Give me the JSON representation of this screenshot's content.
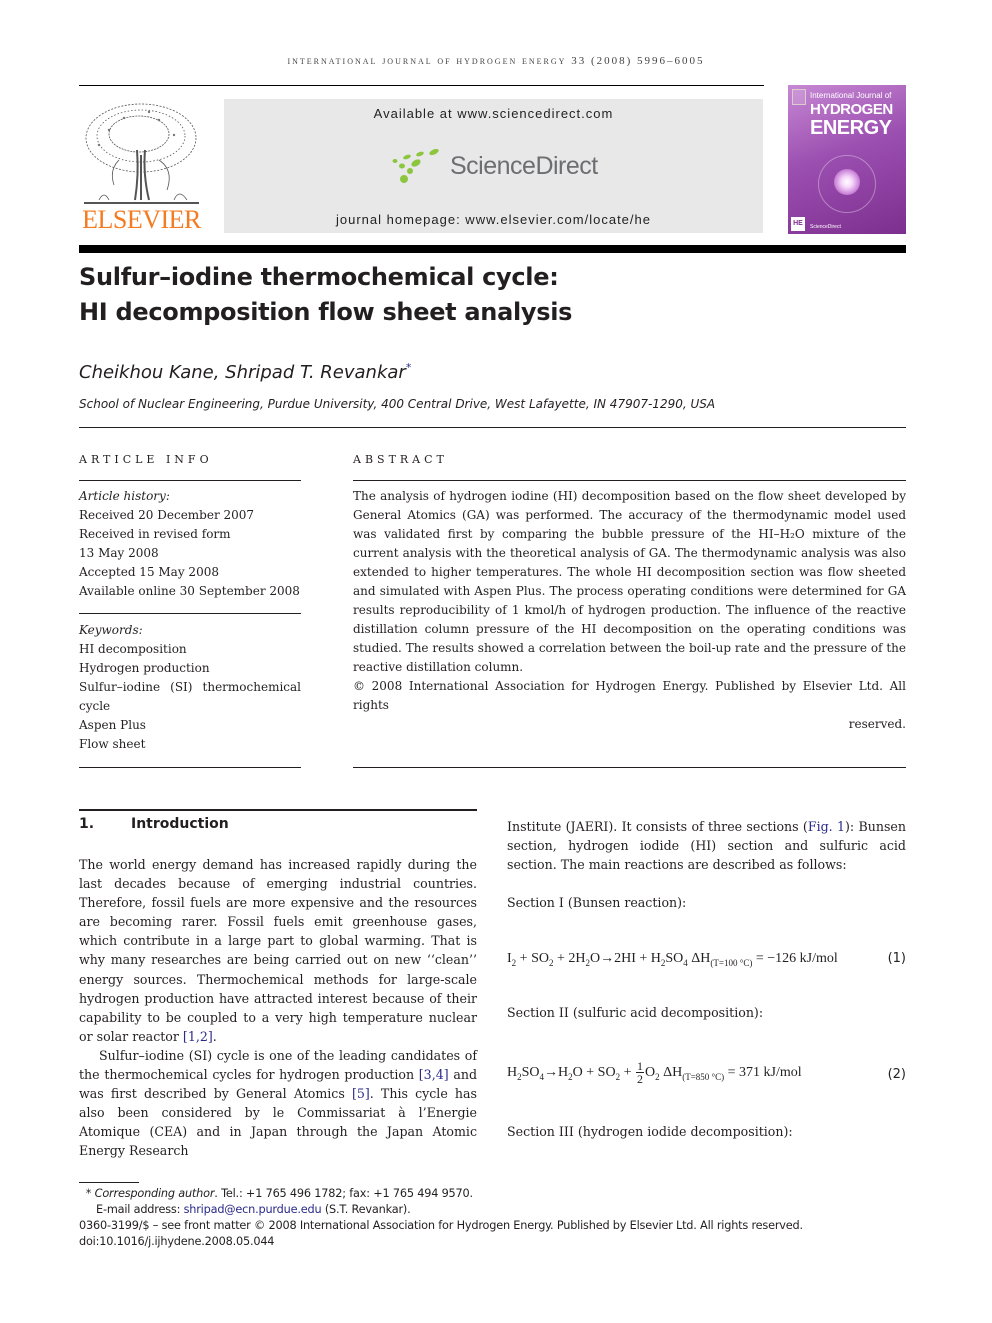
{
  "running_head": "INTERNATIONAL JOURNAL OF HYDROGEN ENERGY 33 (2008) 5996–6005",
  "publisher": {
    "name": "ELSEVIER",
    "color": "#f47b20"
  },
  "sciencedirect": {
    "available": "Available at www.sciencedirect.com",
    "logo_text": "ScienceDirect",
    "homepage": "journal homepage: www.elsevier.com/locate/he",
    "logo_color": "#8cc63f"
  },
  "cover": {
    "line1": "International Journal of",
    "line2": "HYDROGEN",
    "line3": "ENERGY",
    "badge": "HE",
    "footer": "ScienceDirect"
  },
  "article": {
    "title_line1": "Sulfur–iodine thermochemical cycle:",
    "title_line2": "HI decomposition flow sheet analysis",
    "authors": "Cheikhou Kane, Shripad T. Revankar",
    "author_mark": "*",
    "affiliation": "School of Nuclear Engineering, Purdue University, 400 Central Drive, West Lafayette, IN 47907-1290, USA"
  },
  "article_info": {
    "heading": "ARTICLE INFO",
    "history_label": "Article history:",
    "history": [
      "Received 20 December 2007",
      "Received in revised form",
      "13 May 2008",
      "Accepted 15 May 2008",
      "Available online 30 September 2008"
    ],
    "keywords_label": "Keywords:",
    "keywords": [
      "HI decomposition",
      "Hydrogen production",
      "Sulfur–iodine (SI) thermochemical",
      "cycle",
      "Aspen Plus",
      "Flow sheet"
    ]
  },
  "abstract": {
    "heading": "ABSTRACT",
    "text": "The analysis of hydrogen iodine (HI) decomposition based on the flow sheet developed by General Atomics (GA) was performed. The accuracy of the thermodynamic model used was validated first by comparing the bubble pressure of the HI–H₂O mixture of the current analysis with the theoretical analysis of GA. The thermodynamic analysis was also extended to higher temperatures. The whole HI decomposition section was flow sheeted and simulated with Aspen Plus. The process operating conditions were determined for GA results reproducibility of 1 kmol/h of hydrogen production. The influence of the reactive distillation column pressure of the HI decomposition on the operating conditions was studied. The results showed a correlation between the boil-up rate and the pressure of the reactive distillation column.",
    "copyright_line1": "© 2008 International Association for Hydrogen Energy. Published by Elsevier Ltd. All rights",
    "copyright_line2": "reserved."
  },
  "introduction": {
    "number": "1.",
    "title": "Introduction",
    "p1": "The world energy demand has increased rapidly during the last decades because of emerging industrial countries. Therefore, fossil fuels are more expensive and the resources are becoming rarer. Fossil fuels emit greenhouse gases, which contribute in a large part to global warming. That is why many researches are being carried out on new ‘‘clean’’ energy sources. Thermochemical methods for large-scale hydrogen production have attracted interest because of their capability to be coupled to a very high temperature nuclear or solar reactor ",
    "p1_ref": "[1,2]",
    "p1_end": ".",
    "p2_a": "Sulfur–iodine (SI) cycle is one of the leading candidates of the thermochemical cycles for hydrogen production ",
    "p2_ref1": "[3,4]",
    "p2_b": " and was first described by General Atomics ",
    "p2_ref2": "[5]",
    "p2_c": ". This cycle has also been considered by le Commissariat à l’Energie Atomique (CEA) and in Japan through the Japan Atomic Energy Research",
    "p3_a": "Institute (JAERI). It consists of three sections (",
    "p3_ref": "Fig. 1",
    "p3_b": "): Bunsen section, hydrogen iodide (HI) section and sulfuric acid section. The main reactions are described as follows:",
    "section1": "Section I (Bunsen reaction):",
    "section2": "Section II (sulfuric acid decomposition):",
    "section3": "Section III (hydrogen iodide decomposition):"
  },
  "equations": [
    {
      "number": "(1)",
      "enthalpy_condition": "(T=100 °C)",
      "value": "= −126 kJ/mol"
    },
    {
      "number": "(2)",
      "enthalpy_condition": "(T=850 °C)",
      "value": "= 371 kJ/mol"
    }
  ],
  "footnotes": {
    "mark": "*",
    "corresponding_label": "Corresponding author",
    "contact": ". Tel.: +1 765 496 1782; fax: +1 765 494 9570.",
    "email_label": "E-mail address: ",
    "email": "shripad@ecn.purdue.edu",
    "email_suffix": " (S.T. Revankar).",
    "front_matter": "0360-3199/$ – see front matter © 2008 International Association for Hydrogen Energy. Published by Elsevier Ltd. All rights reserved.",
    "doi": "doi:10.1016/j.ijhydene.2008.05.044"
  }
}
